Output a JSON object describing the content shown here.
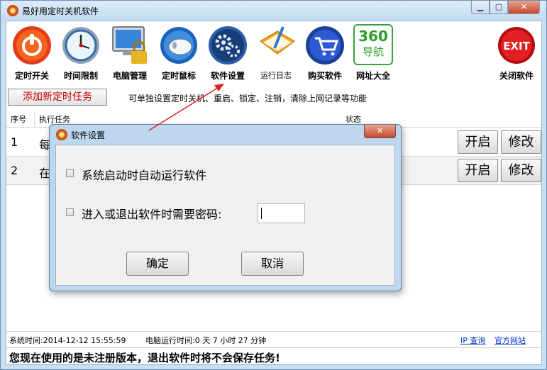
{
  "window": {
    "title": "易好用定时关机软件",
    "min": "▁",
    "max": "▢",
    "close": "✕"
  },
  "toolbar": [
    {
      "name": "timed-switch",
      "label": "定时开关",
      "icon": "power-icon"
    },
    {
      "name": "time-limit",
      "label": "时间限制",
      "icon": "clock-icon"
    },
    {
      "name": "pc-manage",
      "label": "电脑管理",
      "icon": "monitor-lock-icon"
    },
    {
      "name": "timed-mouse",
      "label": "定时鼠标",
      "icon": "mouse-icon"
    },
    {
      "name": "software-settings",
      "label": "软件设置",
      "icon": "gears-icon"
    },
    {
      "name": "run-log",
      "label": "运行日志",
      "icon": "notebook-icon"
    },
    {
      "name": "buy-software",
      "label": "购买软件",
      "icon": "cart-icon"
    },
    {
      "name": "url-directory",
      "label": "网址大全",
      "icon": "360-nav-icon",
      "badge_top": "360",
      "badge_bottom": "导航"
    },
    {
      "name": "close-software",
      "label": "关闭软件",
      "icon": "exit-icon",
      "badge": "EXIT"
    }
  ],
  "actions": {
    "add_task": "添加新定时任务",
    "hint": "可单独设置定时关机、重启、锁定、注销，清除上网记录等功能"
  },
  "table": {
    "headers": {
      "no": "序号",
      "task": "执行任务",
      "status": "状态"
    },
    "rows": [
      {
        "no": "1",
        "task": "每",
        "start": "开启",
        "edit": "修改"
      },
      {
        "no": "2",
        "task": "在",
        "start": "开启",
        "edit": "修改"
      }
    ]
  },
  "status": {
    "system_time": "系统时间:2014-12-12 15:55:59",
    "uptime": "电脑运行时间:0 天 7 小时 27 分钟",
    "ip_link": "IP 查询",
    "site_link": "官方网站",
    "warning": "您现在使用的是未注册版本，退出软件时将不会保存任务!"
  },
  "dialog": {
    "title": "软件设置",
    "close": "✕",
    "opt_autostart": "系统启动时自动运行软件",
    "opt_password": "进入或退出软件时需要密码:",
    "password_value": "",
    "ok": "确定",
    "cancel": "取消"
  },
  "colors": {
    "accent_red": "#c40000",
    "link_blue": "#0033cc",
    "arrow": "#e02020"
  }
}
